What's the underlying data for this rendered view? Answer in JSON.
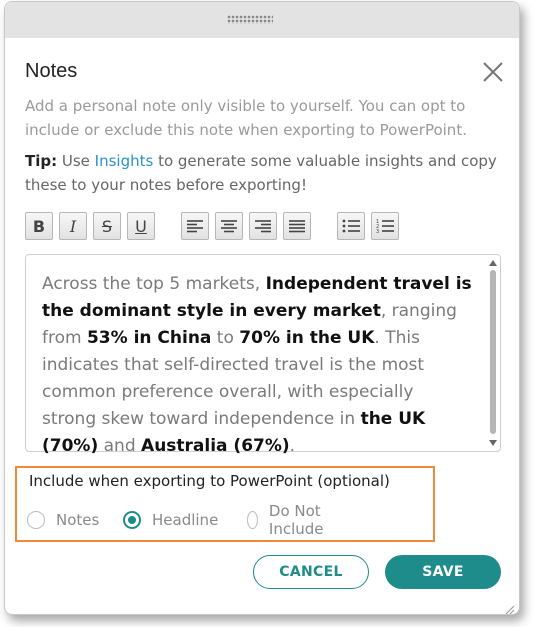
{
  "dialog": {
    "title": "Notes",
    "description": "Add a personal note only visible to yourself. You can opt to include or exclude this note when exporting to PowerPoint.",
    "tip": {
      "label": "Tip:",
      "pre": " Use ",
      "link": "Insights",
      "post": " to generate some valuable insights and copy these to your notes before exporting!"
    }
  },
  "toolbar": {
    "bold": "B",
    "italic": "I",
    "strike": "S",
    "underline": "U",
    "icons": [
      "bold-icon",
      "italic-icon",
      "strikethrough-icon",
      "underline-icon",
      "align-left-icon",
      "align-center-icon",
      "align-right-icon",
      "justify-icon",
      "bullet-list-icon",
      "numbered-list-icon"
    ]
  },
  "editor": {
    "segments": [
      {
        "t": "Across the top 5 markets, ",
        "b": false
      },
      {
        "t": "Independent travel is the dominant style in every market",
        "b": true
      },
      {
        "t": ", ranging from ",
        "b": false
      },
      {
        "t": "53% in China",
        "b": true
      },
      {
        "t": " to ",
        "b": false
      },
      {
        "t": "70% in the UK",
        "b": true
      },
      {
        "t": ". This indicates that self-directed travel is the most common preference overall, with especially strong skew toward independence in ",
        "b": false
      },
      {
        "t": "the UK (70%)",
        "b": true
      },
      {
        "t": " and ",
        "b": false
      },
      {
        "t": "Australia (67%)",
        "b": true
      },
      {
        "t": ".",
        "b": false
      }
    ]
  },
  "export": {
    "label": "Include when exporting to PowerPoint (optional)",
    "options": [
      {
        "label": "Notes",
        "selected": false
      },
      {
        "label": "Headline",
        "selected": true
      },
      {
        "label": "Do Not Include",
        "selected": false
      }
    ]
  },
  "buttons": {
    "cancel": "CANCEL",
    "save": "SAVE"
  },
  "colors": {
    "accent": "#1e8c8a",
    "link": "#2a93c6",
    "highlight": "#f08a3a"
  }
}
